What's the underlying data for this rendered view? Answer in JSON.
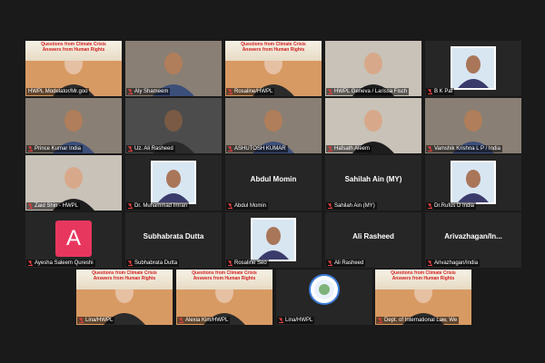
{
  "meeting": {
    "banner_line1": "Questions from Climate Crisis",
    "banner_line2": "Answers from Human Rights",
    "colors": {
      "active_border": "#f5e146",
      "avatar_A": "#e8375f",
      "banner_text": "#d11f1f",
      "mic_muted": "#e0413f"
    }
  },
  "participants": [
    {
      "label": "HWPL Modelator/Mr.goo",
      "video": "banner_person",
      "active": true,
      "muted": false
    },
    {
      "label": "Aly Shameem",
      "video": "person",
      "muted": true
    },
    {
      "label": "Rosaline/HWPL",
      "video": "banner_person",
      "muted": true
    },
    {
      "label": "HWPL Geneva / Larissa Fisch",
      "video": "person_light",
      "muted": true
    },
    {
      "label": "B K Pal",
      "video": "photo_person",
      "muted": true
    },
    {
      "label": "Prince Kumar India",
      "video": "person",
      "muted": true
    },
    {
      "label": "Uz. Ali Rasheed",
      "video": "person_dark",
      "muted": true
    },
    {
      "label": "ASHUTOSH KUMAR",
      "video": "person",
      "muted": true
    },
    {
      "label": "Hafsath Aleem",
      "video": "person_light",
      "muted": true
    },
    {
      "label": "Vamshik Krishna L P / India",
      "video": "person",
      "muted": true
    },
    {
      "label": "Zaid Shin - HWPL",
      "video": "person_light",
      "muted": true
    },
    {
      "label": "Dr. Muhammad Imran",
      "video": "photo_person",
      "muted": true
    },
    {
      "label": "Abdul Momin",
      "name": "Abdul Momin",
      "video": "name_only",
      "muted": true
    },
    {
      "label": "Sahilah Ain (MY)",
      "name": "Sahilah Ain (MY)",
      "video": "name_only",
      "muted": true
    },
    {
      "label": "Dr.Rufus D India",
      "video": "photo_person",
      "muted": true
    },
    {
      "label": "Ayesha Saleem Qureshi",
      "avatar": "A",
      "video": "avatar",
      "muted": true
    },
    {
      "label": "Subhabrata Dutta",
      "name": "Subhabrata Dutta",
      "video": "name_only",
      "muted": true
    },
    {
      "label": "Rosaline Seo",
      "video": "photo_person",
      "muted": true
    },
    {
      "label": "Ali Rasheed",
      "name": "Ali Rasheed",
      "video": "name_only",
      "muted": true
    },
    {
      "label": "Arivazhagan/India",
      "name": "Arivazhagan/In...",
      "video": "name_only",
      "muted": true
    },
    {
      "label": "Lina/HWPL",
      "video": "banner_person",
      "muted": true
    },
    {
      "label": "Alexia Kim/HWPL",
      "video": "banner_person",
      "muted": true
    },
    {
      "label": "Lina/HWPL",
      "video": "logo",
      "muted": true
    },
    {
      "label": "Dept. of International Law, We",
      "video": "banner_person",
      "muted": true
    }
  ]
}
